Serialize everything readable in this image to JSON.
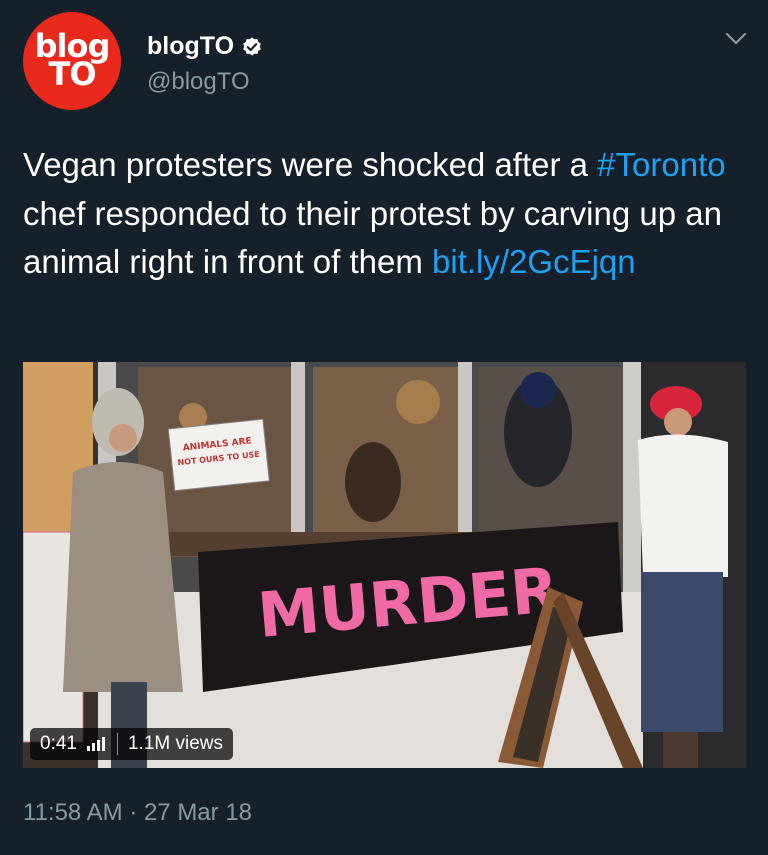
{
  "author": {
    "avatar_top": "blog",
    "avatar_bottom": "TO",
    "display_name": "blogTO",
    "handle": "@blogTO",
    "verified_icon": "verified-badge-icon",
    "menu_icon": "chevron-down-icon"
  },
  "tweet": {
    "text_part1": "Vegan protesters were shocked after a ",
    "hashtag": "#Toronto",
    "text_part2": " chef responded to their protest by carving up an animal right in front of them ",
    "link": "bit.ly/2GcEjqn"
  },
  "media": {
    "sign_line1": "ANIMALS ARE",
    "sign_line2": "NOT OURS TO USE",
    "banner": "MURDER",
    "duration": "0:41",
    "views_icon": "bar-chart-icon",
    "views": "1.1M views"
  },
  "timestamp": "11:58 AM · 27 Mar 18",
  "colors": {
    "background": "#15202b",
    "link": "#1da1f2",
    "secondary_text": "#8899a6",
    "avatar": "#e8291c",
    "banner_text": "#f06aa8"
  }
}
